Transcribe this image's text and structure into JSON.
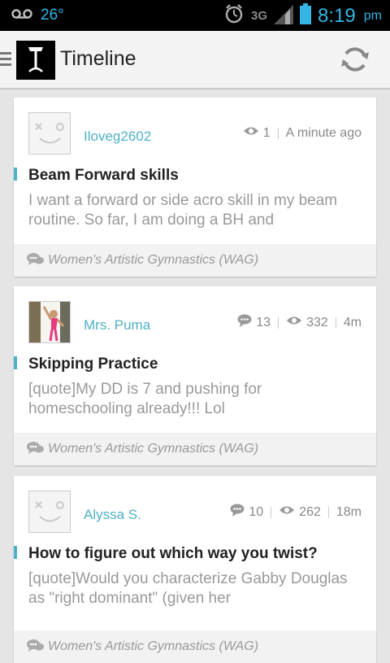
{
  "status_bar": {
    "temperature": "26°",
    "network": "3G",
    "time": "8:19",
    "ampm": "pm"
  },
  "action_bar": {
    "title": "Timeline"
  },
  "posts": [
    {
      "username": "Iloveg2602",
      "comments": "",
      "views": "1",
      "time": "A minute ago",
      "title": "Beam Forward skills",
      "excerpt": "I want a forward or side acro skill in my beam routine.  So far, I am doing a BH and",
      "forum": "Women's Artistic Gymnastics (WAG)"
    },
    {
      "username": "Mrs. Puma",
      "comments": "13",
      "views": "332",
      "time": "4m",
      "title": "Skipping Practice",
      "excerpt": "[quote]My DD is 7 and pushing for homeschooling already!!! Lol",
      "forum": "Women's Artistic Gymnastics (WAG)"
    },
    {
      "username": "Alyssa S.",
      "comments": "10",
      "views": "262",
      "time": "18m",
      "title": "How to figure out which way you twist?",
      "excerpt": "[quote]Would you characterize Gabby Douglas as \"right dominant\" (given her",
      "forum": "Women's Artistic Gymnastics (WAG)"
    }
  ],
  "colors": {
    "accent": "#4fb0c6",
    "status_icon": "#33b5e5"
  }
}
